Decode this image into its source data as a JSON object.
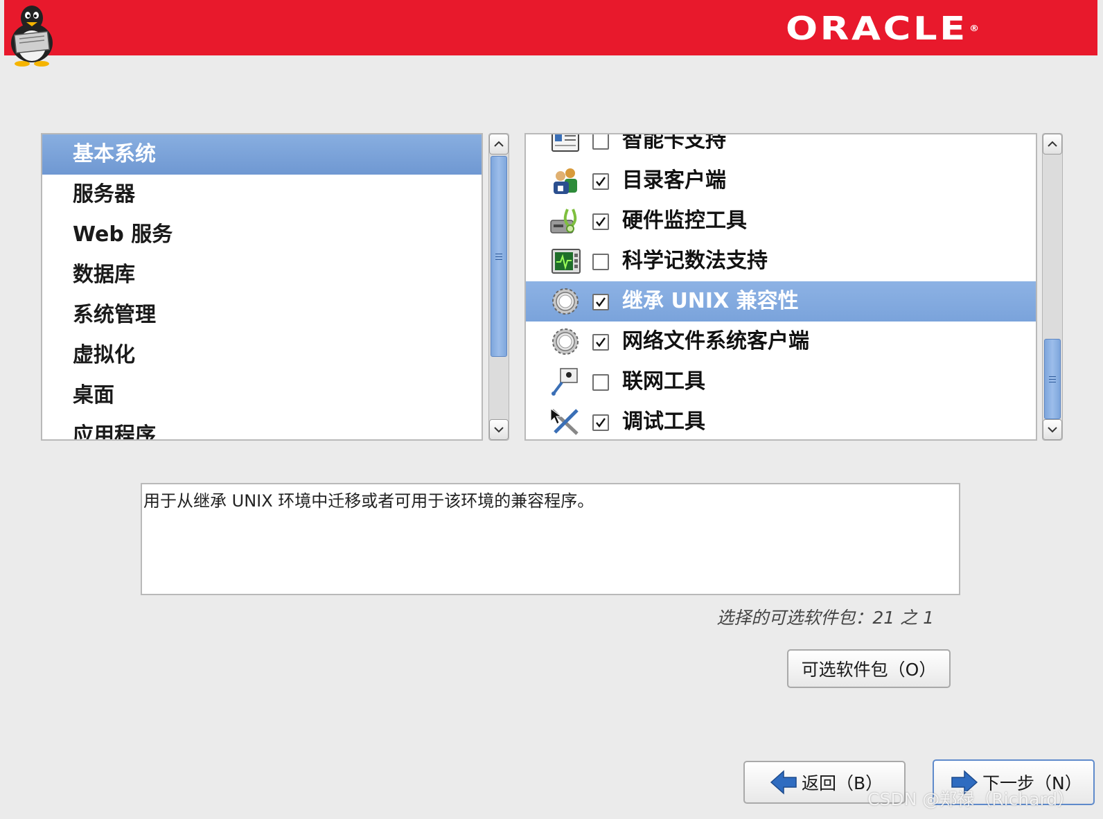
{
  "header": {
    "brand": "ORACLE",
    "brand_mark": "®",
    "color": "#e8192c"
  },
  "groups": {
    "items": [
      {
        "label": "基本系统",
        "selected": true
      },
      {
        "label": "服务器",
        "selected": false
      },
      {
        "label": "Web 服务",
        "selected": false
      },
      {
        "label": "数据库",
        "selected": false
      },
      {
        "label": "系统管理",
        "selected": false
      },
      {
        "label": "虚拟化",
        "selected": false
      },
      {
        "label": "桌面",
        "selected": false
      },
      {
        "label": "应用程序",
        "selected": false
      }
    ]
  },
  "packages": {
    "items": [
      {
        "label": "智能卡支持",
        "checked": false,
        "icon": "smartcard-icon"
      },
      {
        "label": "目录客户端",
        "checked": true,
        "icon": "directory-client-icon"
      },
      {
        "label": "硬件监控工具",
        "checked": true,
        "icon": "hardware-monitor-icon"
      },
      {
        "label": "科学记数法支持",
        "checked": false,
        "icon": "scientific-icon"
      },
      {
        "label": "继承 UNIX 兼容性",
        "checked": true,
        "icon": "gear-icon",
        "selected": true
      },
      {
        "label": "网络文件系统客户端",
        "checked": true,
        "icon": "gear-icon"
      },
      {
        "label": "联网工具",
        "checked": false,
        "icon": "network-tools-icon"
      },
      {
        "label": "调试工具",
        "checked": true,
        "icon": "debug-tools-icon"
      }
    ]
  },
  "description": "用于从继承 UNIX 环境中迁移或者可用于该环境的兼容程序。",
  "selection_count": "选择的可选软件包：21 之 1",
  "buttons": {
    "optional": "可选软件包（O）",
    "back": "返回（B）",
    "next": "下一步（N）"
  },
  "watermark": "CSDN @郑禄（Richard）"
}
